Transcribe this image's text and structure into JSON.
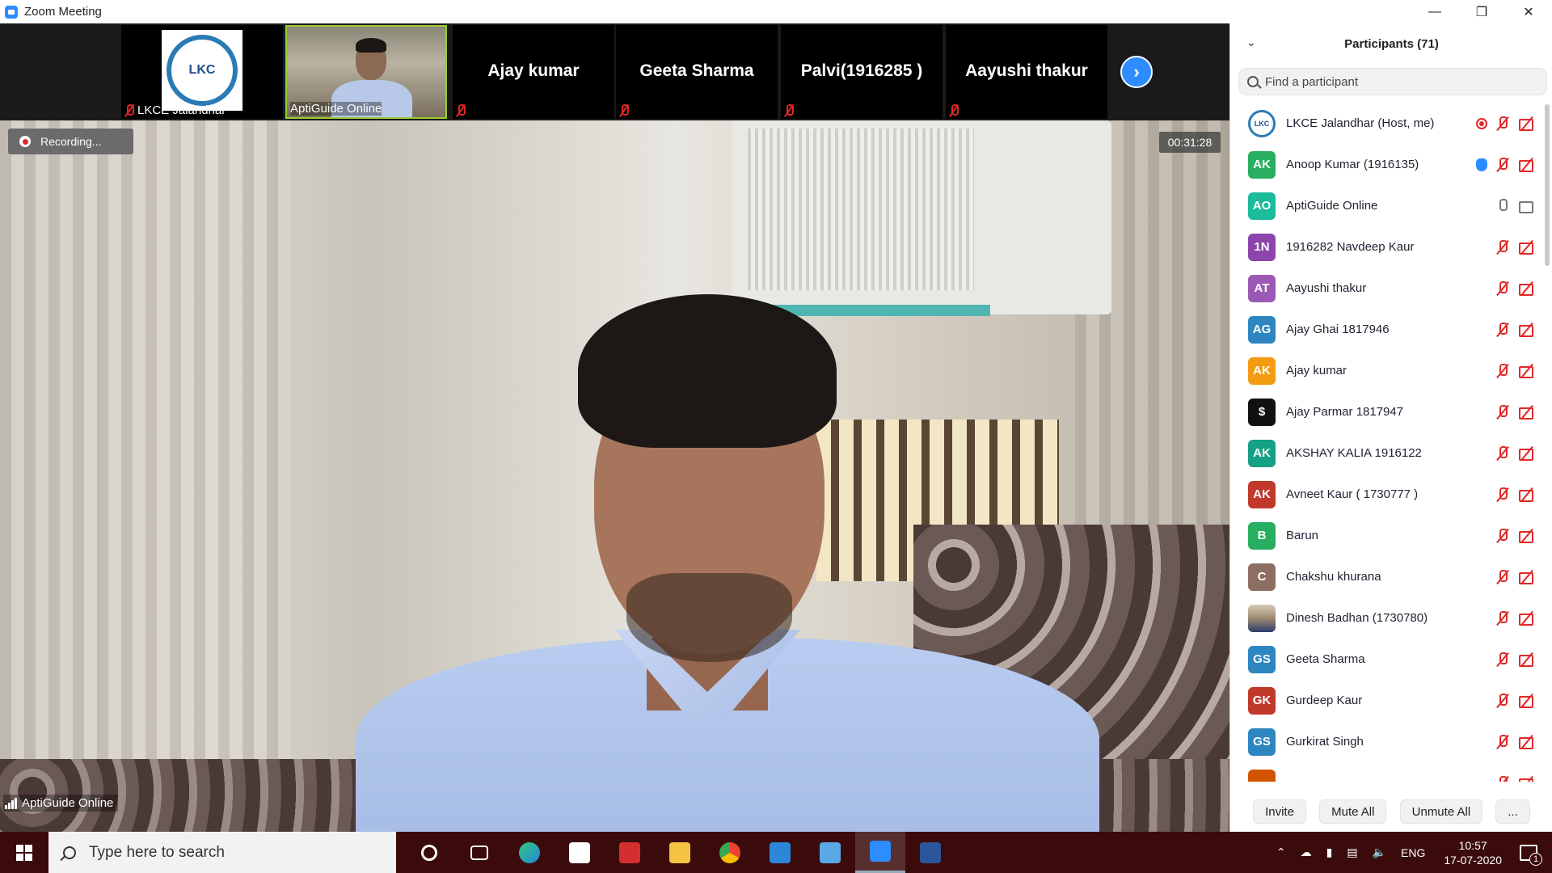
{
  "window": {
    "title": "Zoom Meeting",
    "controls": [
      "minimize-icon",
      "restore-icon",
      "close-icon"
    ]
  },
  "thumbnails": [
    {
      "name": "LKCE Jalandhar",
      "display": "logo",
      "logo_text": "LKC",
      "muted": true
    },
    {
      "name": "AptiGuide Online",
      "display": "video",
      "muted": false,
      "active": true
    },
    {
      "name": "Ajay kumar",
      "display": "name",
      "muted": true
    },
    {
      "name": "Geeta Sharma",
      "display": "name",
      "muted": true
    },
    {
      "name": "Palvi(1916285 )",
      "display": "name",
      "muted": true
    },
    {
      "name": "Aayushi thakur",
      "display": "name",
      "muted": true
    }
  ],
  "main_video": {
    "recording_label": "Recording...",
    "timer": "00:31:28",
    "speaker_name": "AptiGuide Online"
  },
  "participants": {
    "title": "Participants (71)",
    "search_placeholder": "Find a participant",
    "list": [
      {
        "initials": "",
        "avatar": "lkc-logo",
        "color": "#ffffff",
        "name": "LKCE Jalandhar (Host, me)",
        "icons": [
          "record-icon",
          "mic-off-icon",
          "video-off-icon"
        ]
      },
      {
        "initials": "AK",
        "color": "#27ae60",
        "name": "Anoop Kumar (1916135)",
        "icons": [
          "raised-hand-icon",
          "mic-off-icon",
          "video-off-icon"
        ]
      },
      {
        "initials": "AO",
        "color": "#1abc9c",
        "name": "AptiGuide Online",
        "icons": [
          "mic-on-icon",
          "video-on-icon"
        ]
      },
      {
        "initials": "1N",
        "color": "#8e44ad",
        "name": "1916282 Navdeep Kaur",
        "icons": [
          "mic-off-icon",
          "video-off-icon"
        ]
      },
      {
        "initials": "AT",
        "color": "#9b59b6",
        "name": "Aayushi thakur",
        "icons": [
          "mic-off-icon",
          "video-off-icon"
        ]
      },
      {
        "initials": "AG",
        "color": "#2e86c1",
        "name": "Ajay Ghai 1817946",
        "icons": [
          "mic-off-icon",
          "video-off-icon"
        ]
      },
      {
        "initials": "AK",
        "color": "#f39c12",
        "name": "Ajay kumar",
        "icons": [
          "mic-off-icon",
          "video-off-icon"
        ]
      },
      {
        "initials": "$",
        "avatar": "dollar-logo",
        "color": "#111111",
        "name": "Ajay Parmar 1817947",
        "icons": [
          "mic-off-icon",
          "video-off-icon"
        ]
      },
      {
        "initials": "AK",
        "color": "#16a085",
        "name": "AKSHAY KALIA 1916122",
        "icons": [
          "mic-off-icon",
          "video-off-icon"
        ]
      },
      {
        "initials": "AK",
        "color": "#c0392b",
        "name": "Avneet Kaur ( 1730777 )",
        "icons": [
          "mic-off-icon",
          "video-off-icon"
        ]
      },
      {
        "initials": "B",
        "color": "#27ae60",
        "name": "Barun",
        "icons": [
          "mic-off-icon",
          "video-off-icon"
        ]
      },
      {
        "initials": "C",
        "color": "#8d6e63",
        "name": "Chakshu khurana",
        "icons": [
          "mic-off-icon",
          "video-off-icon"
        ]
      },
      {
        "initials": "",
        "avatar": "photo",
        "color": "#9e8a70",
        "name": "Dinesh Badhan (1730780)",
        "icons": [
          "mic-off-icon",
          "video-off-icon"
        ]
      },
      {
        "initials": "GS",
        "color": "#2e86c1",
        "name": "Geeta Sharma",
        "icons": [
          "mic-off-icon",
          "video-off-icon"
        ]
      },
      {
        "initials": "GK",
        "color": "#c0392b",
        "name": "Gurdeep Kaur",
        "icons": [
          "mic-off-icon",
          "video-off-icon"
        ]
      },
      {
        "initials": "GS",
        "color": "#2e86c1",
        "name": "Gurkirat Singh",
        "icons": [
          "mic-off-icon",
          "video-off-icon"
        ]
      },
      {
        "initials": "",
        "color": "#d35400",
        "name": "",
        "icons": [
          "mic-off-icon",
          "video-off-icon"
        ]
      }
    ],
    "footer": {
      "invite": "Invite",
      "mute_all": "Mute All",
      "unmute_all": "Unmute All",
      "more": "..."
    }
  },
  "taskbar": {
    "search_placeholder": "Type here to search",
    "apps": [
      {
        "icon": "cortana-icon",
        "color": "#ffffff"
      },
      {
        "icon": "task-view-icon",
        "color": "#ffffff"
      },
      {
        "icon": "edge-icon",
        "color": "#1f8ad6"
      },
      {
        "icon": "store-icon",
        "color": "#ffffff"
      },
      {
        "icon": "gift-icon",
        "color": "#d32f2f"
      },
      {
        "icon": "file-explorer-icon",
        "color": "#f5c342"
      },
      {
        "icon": "chrome-icon",
        "color": "#34a853"
      },
      {
        "icon": "mail-icon",
        "color": "#2b88d8"
      },
      {
        "icon": "laptop-icon",
        "color": "#5aa9e6"
      },
      {
        "icon": "zoom-icon",
        "color": "#2d8cff",
        "active": true
      },
      {
        "icon": "word-icon",
        "color": "#2b579a"
      }
    ],
    "tray": {
      "language": "ENG",
      "time": "10:57",
      "date": "17-07-2020",
      "notifications": "1"
    }
  }
}
